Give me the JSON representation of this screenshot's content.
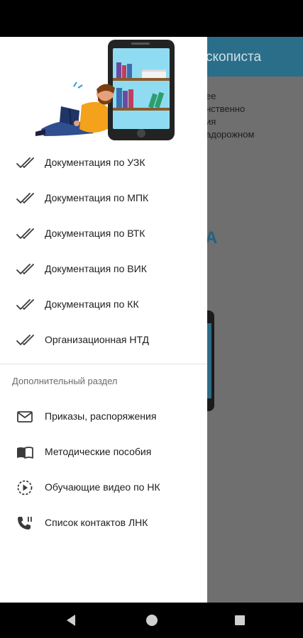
{
  "background": {
    "title": "скописта",
    "lines": [
      "ее",
      "нственно",
      "ия",
      "адорожном"
    ]
  },
  "menu": {
    "primary_items": [
      {
        "label": "Документация по УЗК",
        "icon": "double-check-icon"
      },
      {
        "label": "Документация по МПК",
        "icon": "double-check-icon"
      },
      {
        "label": "Документация по ВТК",
        "icon": "double-check-icon"
      },
      {
        "label": "Документация по ВИК",
        "icon": "double-check-icon"
      },
      {
        "label": "Документация по КК",
        "icon": "double-check-icon"
      },
      {
        "label": "Организационная НТД",
        "icon": "double-check-icon"
      }
    ],
    "section_header": "Дополнительный раздел",
    "secondary_items": [
      {
        "label": "Приказы, распоряжения",
        "icon": "mail-icon"
      },
      {
        "label": "Методические пособия",
        "icon": "book-icon"
      },
      {
        "label": "Обучающие видео по НК",
        "icon": "play-circle-icon"
      },
      {
        "label": "Список контактов ЛНК",
        "icon": "phone-icon"
      }
    ]
  },
  "colors": {
    "toolbar": "#2b6e8a",
    "scrim": "#6f6f6f",
    "drawer": "#ffffff",
    "icon": "#3a3a3a"
  }
}
